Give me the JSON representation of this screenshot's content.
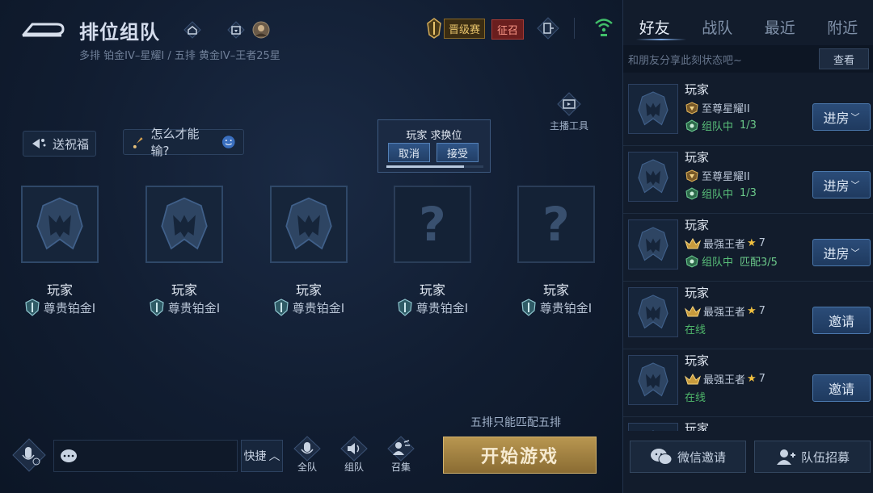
{
  "header": {
    "title": "排位组队",
    "subtitle": "多排  铂金IV–星耀I / 五排 黄金IV–王者25星",
    "promotion_label": "晋级赛",
    "recruit_label": "征召"
  },
  "chips": {
    "bless": "送祝福",
    "how_lose": "怎么才能输?"
  },
  "streamer_tool": "主播工具",
  "swap_popup": {
    "title": "玩家 求换位",
    "cancel": "取消",
    "accept": "接受",
    "timer_fraction": 0.8
  },
  "slots": [
    {
      "name": "玩家",
      "rank": "尊贵铂金I",
      "filled": true
    },
    {
      "name": "玩家",
      "rank": "尊贵铂金I",
      "filled": true
    },
    {
      "name": "玩家",
      "rank": "尊贵铂金I",
      "filled": true
    },
    {
      "name": "玩家",
      "rank": "尊贵铂金I",
      "filled": false,
      "placeholder": "?"
    },
    {
      "name": "玩家",
      "rank": "尊贵铂金I",
      "filled": false,
      "placeholder": "?"
    }
  ],
  "notice": "五排只能匹配五排",
  "start_button": "开始游戏",
  "bottom_bar": {
    "quick": "快捷",
    "all_team": "全队",
    "team": "组队",
    "gather": "召集"
  },
  "sidebar": {
    "tabs": [
      "好友",
      "战队",
      "最近",
      "附近"
    ],
    "share_placeholder": "和朋友分享此刻状态吧~",
    "view_button": "查看",
    "friends": [
      {
        "name": "玩家",
        "rank": "至尊星耀II",
        "status": "组队中",
        "extra": "1/3",
        "action": "进房",
        "status_type": "team"
      },
      {
        "name": "玩家",
        "rank": "至尊星耀II",
        "status": "组队中",
        "extra": "1/3",
        "action": "进房",
        "status_type": "team"
      },
      {
        "name": "玩家",
        "rank": "最强王者",
        "stars": "7",
        "status": "组队中",
        "extra": "匹配3/5",
        "action": "进房",
        "status_type": "team"
      },
      {
        "name": "玩家",
        "rank": "最强王者",
        "stars": "7",
        "status": "在线",
        "extra": "",
        "action": "邀请",
        "status_type": "online"
      },
      {
        "name": "玩家",
        "rank": "最强王者",
        "stars": "7",
        "status": "在线",
        "extra": "",
        "action": "邀请",
        "status_type": "online"
      },
      {
        "name": "玩家"
      }
    ],
    "wechat_invite": "微信邀请",
    "team_recruit": "队伍招募"
  },
  "colors": {
    "accent_gold": "#b89650",
    "team_green": "#59c07a",
    "button_blue": "#2b4c78"
  }
}
